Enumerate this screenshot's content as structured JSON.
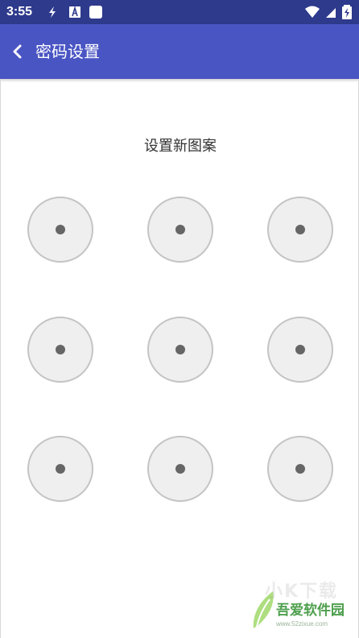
{
  "status_bar": {
    "time": "3:55",
    "icons": [
      "sync-icon",
      "font-a-icon",
      "square-notification-icon",
      "wifi-icon",
      "cell-signal-icon",
      "battery-charging-icon"
    ],
    "background": "#2e3a8c"
  },
  "app_bar": {
    "title": "密码设置",
    "back_icon": "chevron-left-icon",
    "background": "#4a55c4"
  },
  "pattern_screen": {
    "prompt": "设置新图案",
    "dots": [
      {
        "row": 1,
        "col": 1
      },
      {
        "row": 1,
        "col": 2
      },
      {
        "row": 1,
        "col": 3
      },
      {
        "row": 2,
        "col": 1
      },
      {
        "row": 2,
        "col": 2
      },
      {
        "row": 2,
        "col": 3
      },
      {
        "row": 3,
        "col": 1
      },
      {
        "row": 3,
        "col": 2
      },
      {
        "row": 3,
        "col": 3
      }
    ]
  },
  "watermark": {
    "ghost_text": "小K下载",
    "name": "吾爱软件园",
    "url": "www.52zixue.com"
  },
  "colors": {
    "dot_fill": "#efefef",
    "dot_border": "#c4c4c4",
    "dot_center": "#666666",
    "prompt_text": "#333333"
  }
}
